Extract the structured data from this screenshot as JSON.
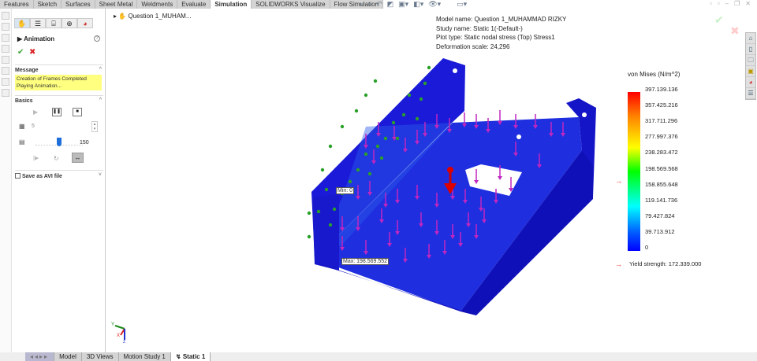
{
  "ribbon": {
    "tabs": [
      "Features",
      "Sketch",
      "Surfaces",
      "Sheet Metal",
      "Weldments",
      "Evaluate",
      "Simulation",
      "SOLIDWORKS Visualize",
      "Flow Simulation"
    ],
    "active_tab": "Simulation"
  },
  "panel": {
    "title": "Animation",
    "help": "?",
    "message_header": "Message",
    "message_lines": [
      "Creation of Frames Completed",
      "Playing Animation..."
    ],
    "basics_header": "Basics",
    "frames_value": "5",
    "speed_value": "150",
    "speed_fraction": 0.45,
    "save_avi_label": "Save as AVI file",
    "save_avi_checked": false
  },
  "tree": {
    "root": "Question 1_MUHAM..."
  },
  "plot_info": {
    "model_name": "Model name: Question 1_MUHAMMAD RIZKY",
    "study_name": "Study name: Static 1(-Default-)",
    "plot_type": "Plot type: Static nodal stress (Top) Stress1",
    "deformation_scale": "Deformation scale: 24,296"
  },
  "legend": {
    "title": "von Mises (N/m^2)",
    "ticks": [
      "397.139.136",
      "357.425.216",
      "317.711.296",
      "277.997.376",
      "238.283.472",
      "198.569.568",
      "158.855.648",
      "119.141.736",
      "79.427.824",
      "39.713.912",
      "0"
    ],
    "yield_strength": "Yield strength: 172.339.000",
    "colors": [
      "#ff0000",
      "#ffff00",
      "#00ff00",
      "#00ffff",
      "#0000ff"
    ]
  },
  "annotations": {
    "min": "Min: 0",
    "max": "Max: 198.569.552"
  },
  "triad": {
    "x": "X",
    "y": "Y",
    "z": "Z"
  },
  "bottom_tabs": [
    "Model",
    "3D Views",
    "Motion Study 1",
    "Static 1"
  ],
  "bottom_active": "Static 1",
  "icons": {
    "right_toolbar": [
      "home-icon",
      "part-icon",
      "folder-icon",
      "view-palette-icon",
      "appearance-icon",
      "properties-icon"
    ]
  }
}
